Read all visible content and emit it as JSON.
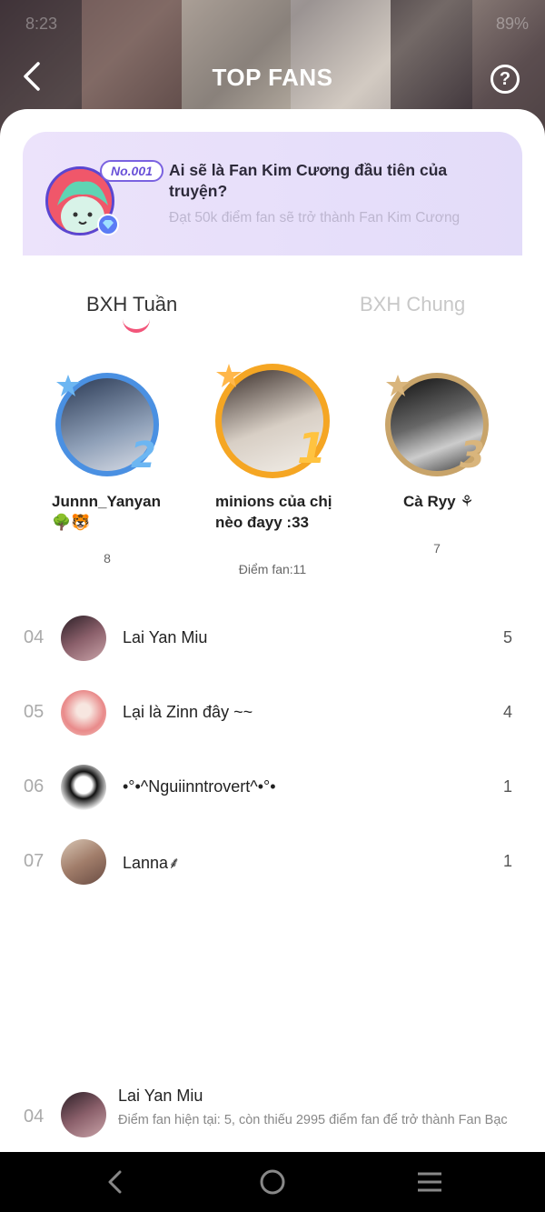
{
  "status_bar": {
    "time": "8:23",
    "battery": "89%"
  },
  "header": {
    "title": "TOP FANS",
    "help_label": "?"
  },
  "banner": {
    "badge": "No.001",
    "title": "Ai sẽ là Fan Kim Cương đầu tiên của truyện?",
    "subtitle": "Đạt 50k điểm fan sẽ trở thành Fan Kim Cương"
  },
  "tabs": [
    {
      "label": "BXH Tuần",
      "active": true
    },
    {
      "label": "BXH Chung",
      "active": false
    }
  ],
  "podium": {
    "first": {
      "rank": "1",
      "name": "minions của chị nèo đayy :33",
      "score": "Điểm fan:11",
      "ring_color": "#f5a623"
    },
    "second": {
      "rank": "2",
      "name": "Junnn_Yanyan 🌳🐯",
      "score": "8",
      "ring_color": "#4a90e2"
    },
    "third": {
      "rank": "3",
      "name": "Cà Ryy ⚘",
      "score": "7",
      "ring_color": "#c8a46a"
    }
  },
  "list": [
    {
      "rank": "04",
      "name": "Lai Yan Miu",
      "score": "5"
    },
    {
      "rank": "05",
      "name": "Lại là Zinn đây ~~",
      "score": "4"
    },
    {
      "rank": "06",
      "name": "•°•^Nguiinntrovert^•°•",
      "score": "1"
    },
    {
      "rank": "07",
      "name": "Lanna⸙",
      "score": "1"
    }
  ],
  "self": {
    "rank": "04",
    "name": "Lai Yan Miu",
    "description": "Điểm fan hiện tại: 5, còn thiếu 2995 điểm fan để trở thành Fan Bạc"
  },
  "icons": {
    "back": "chevron-left-icon",
    "help": "question-circle-icon",
    "gem": "diamond-icon",
    "sys_back": "back-arrow-icon",
    "sys_home": "home-circle-icon",
    "sys_menu": "menu-icon"
  }
}
